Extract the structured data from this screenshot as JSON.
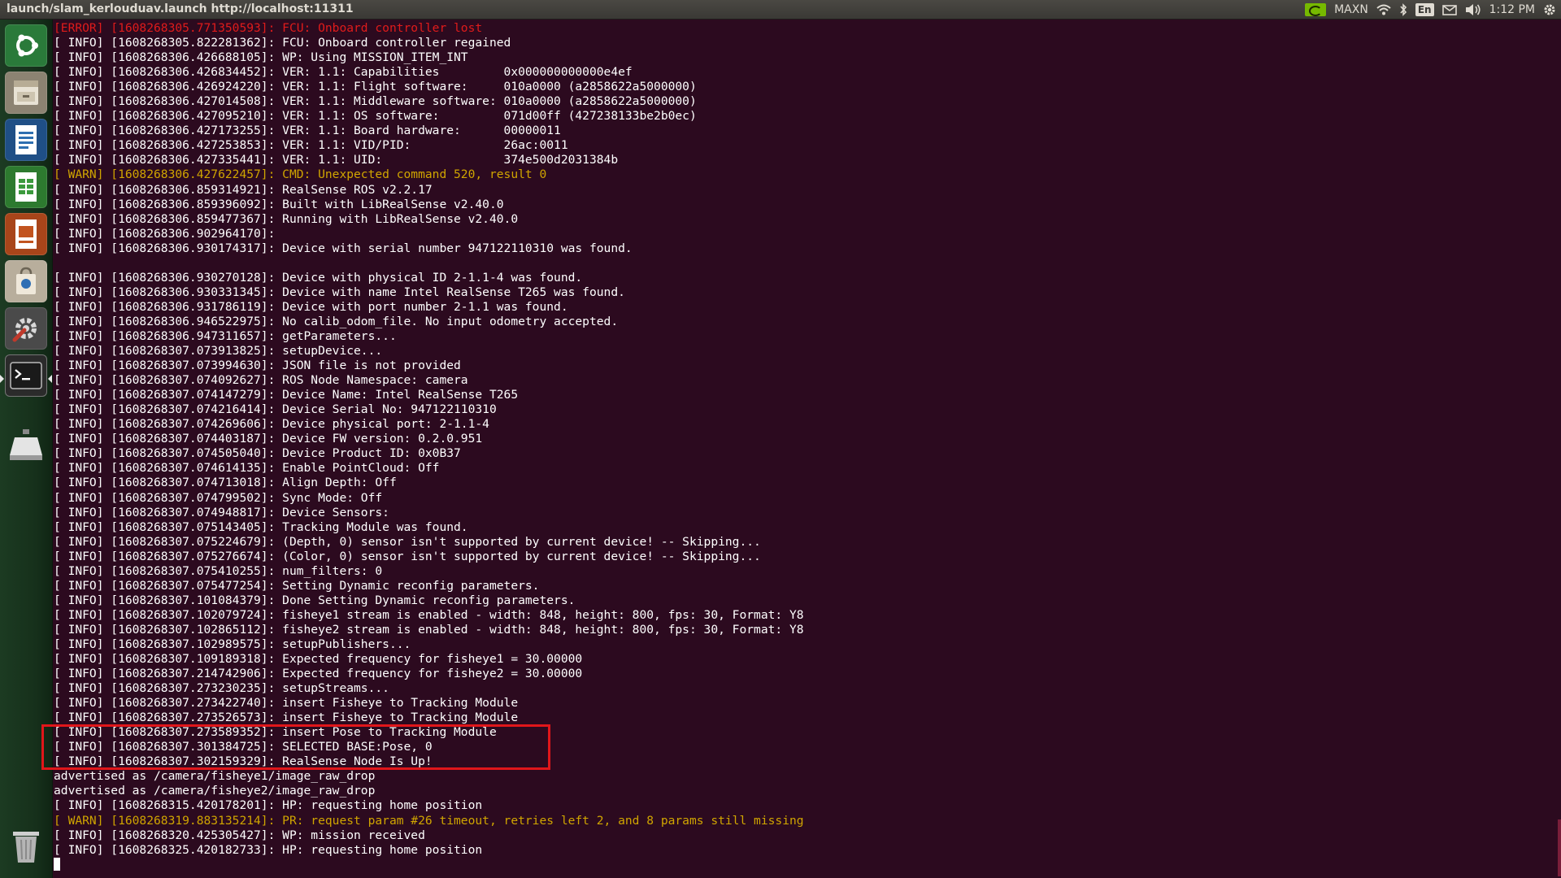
{
  "window": {
    "title": "launch/slam_kerlouduav.launch http://localhost:11311"
  },
  "tray": {
    "power_mode": "MAXN",
    "keyboard_layout": "En",
    "clock": "1:12 PM",
    "icons": [
      "nvidia-icon",
      "wifi-icon",
      "bluetooth-icon",
      "keyboard-icon",
      "mail-icon",
      "volume-icon",
      "gear-icon"
    ]
  },
  "launcher": {
    "items": [
      {
        "name": "dash-home",
        "icon": "ubuntu-logo-icon",
        "color": "#2a7a3a"
      },
      {
        "name": "files",
        "icon": "file-cabinet-icon",
        "color": "#a49a86"
      },
      {
        "name": "writer",
        "icon": "document-icon",
        "color": "#2e6fb0"
      },
      {
        "name": "calc",
        "icon": "spreadsheet-icon",
        "color": "#3b9a3d"
      },
      {
        "name": "impress",
        "icon": "presentation-icon",
        "color": "#c2541f"
      },
      {
        "name": "software",
        "icon": "shopping-bag-icon",
        "color": "#d8d2c6"
      },
      {
        "name": "settings",
        "icon": "settings-icon",
        "color": "#6a6a6a"
      },
      {
        "name": "terminal",
        "icon": "terminal-icon",
        "color": "#3a3a3a"
      },
      {
        "name": "drive",
        "icon": "drive-icon",
        "color": "#cfcfcf"
      },
      {
        "name": "trash",
        "icon": "trash-icon",
        "color": "#bdbdbd"
      }
    ]
  },
  "terminal": {
    "lines": [
      {
        "level": "error",
        "text": "[ERROR] [1608268305.771350593]: FCU: Onboard controller lost"
      },
      {
        "level": "info",
        "text": "[ INFO] [1608268305.822281362]: FCU: Onboard controller regained"
      },
      {
        "level": "info",
        "text": "[ INFO] [1608268306.426688105]: WP: Using MISSION_ITEM_INT"
      },
      {
        "level": "info",
        "text": "[ INFO] [1608268306.426834452]: VER: 1.1: Capabilities         0x000000000000e4ef"
      },
      {
        "level": "info",
        "text": "[ INFO] [1608268306.426924220]: VER: 1.1: Flight software:     010a0000 (a2858622a5000000)"
      },
      {
        "level": "info",
        "text": "[ INFO] [1608268306.427014508]: VER: 1.1: Middleware software: 010a0000 (a2858622a5000000)"
      },
      {
        "level": "info",
        "text": "[ INFO] [1608268306.427095210]: VER: 1.1: OS software:         071d00ff (427238133be2b0ec)"
      },
      {
        "level": "info",
        "text": "[ INFO] [1608268306.427173255]: VER: 1.1: Board hardware:      00000011"
      },
      {
        "level": "info",
        "text": "[ INFO] [1608268306.427253853]: VER: 1.1: VID/PID:             26ac:0011"
      },
      {
        "level": "info",
        "text": "[ INFO] [1608268306.427335441]: VER: 1.1: UID:                 374e500d2031384b"
      },
      {
        "level": "warn",
        "text": "[ WARN] [1608268306.427622457]: CMD: Unexpected command 520, result 0"
      },
      {
        "level": "info",
        "text": "[ INFO] [1608268306.859314921]: RealSense ROS v2.2.17"
      },
      {
        "level": "info",
        "text": "[ INFO] [1608268306.859396092]: Built with LibRealSense v2.40.0"
      },
      {
        "level": "info",
        "text": "[ INFO] [1608268306.859477367]: Running with LibRealSense v2.40.0"
      },
      {
        "level": "info",
        "text": "[ INFO] [1608268306.902964170]:"
      },
      {
        "level": "info",
        "text": "[ INFO] [1608268306.930174317]: Device with serial number 947122110310 was found."
      },
      {
        "level": "plain",
        "text": ""
      },
      {
        "level": "info",
        "text": "[ INFO] [1608268306.930270128]: Device with physical ID 2-1.1-4 was found."
      },
      {
        "level": "info",
        "text": "[ INFO] [1608268306.930331345]: Device with name Intel RealSense T265 was found."
      },
      {
        "level": "info",
        "text": "[ INFO] [1608268306.931786119]: Device with port number 2-1.1 was found."
      },
      {
        "level": "info",
        "text": "[ INFO] [1608268306.946522975]: No calib_odom_file. No input odometry accepted."
      },
      {
        "level": "info",
        "text": "[ INFO] [1608268306.947311657]: getParameters..."
      },
      {
        "level": "info",
        "text": "[ INFO] [1608268307.073913825]: setupDevice..."
      },
      {
        "level": "info",
        "text": "[ INFO] [1608268307.073994630]: JSON file is not provided"
      },
      {
        "level": "info",
        "text": "[ INFO] [1608268307.074092627]: ROS Node Namespace: camera"
      },
      {
        "level": "info",
        "text": "[ INFO] [1608268307.074147279]: Device Name: Intel RealSense T265"
      },
      {
        "level": "info",
        "text": "[ INFO] [1608268307.074216414]: Device Serial No: 947122110310"
      },
      {
        "level": "info",
        "text": "[ INFO] [1608268307.074269606]: Device physical port: 2-1.1-4"
      },
      {
        "level": "info",
        "text": "[ INFO] [1608268307.074403187]: Device FW version: 0.2.0.951"
      },
      {
        "level": "info",
        "text": "[ INFO] [1608268307.074505040]: Device Product ID: 0x0B37"
      },
      {
        "level": "info",
        "text": "[ INFO] [1608268307.074614135]: Enable PointCloud: Off"
      },
      {
        "level": "info",
        "text": "[ INFO] [1608268307.074713018]: Align Depth: Off"
      },
      {
        "level": "info",
        "text": "[ INFO] [1608268307.074799502]: Sync Mode: Off"
      },
      {
        "level": "info",
        "text": "[ INFO] [1608268307.074948817]: Device Sensors:"
      },
      {
        "level": "info",
        "text": "[ INFO] [1608268307.075143405]: Tracking Module was found."
      },
      {
        "level": "info",
        "text": "[ INFO] [1608268307.075224679]: (Depth, 0) sensor isn't supported by current device! -- Skipping..."
      },
      {
        "level": "info",
        "text": "[ INFO] [1608268307.075276674]: (Color, 0) sensor isn't supported by current device! -- Skipping..."
      },
      {
        "level": "info",
        "text": "[ INFO] [1608268307.075410255]: num_filters: 0"
      },
      {
        "level": "info",
        "text": "[ INFO] [1608268307.075477254]: Setting Dynamic reconfig parameters."
      },
      {
        "level": "info",
        "text": "[ INFO] [1608268307.101084379]: Done Setting Dynamic reconfig parameters."
      },
      {
        "level": "info",
        "text": "[ INFO] [1608268307.102079724]: fisheye1 stream is enabled - width: 848, height: 800, fps: 30, Format: Y8"
      },
      {
        "level": "info",
        "text": "[ INFO] [1608268307.102865112]: fisheye2 stream is enabled - width: 848, height: 800, fps: 30, Format: Y8"
      },
      {
        "level": "info",
        "text": "[ INFO] [1608268307.102989575]: setupPublishers..."
      },
      {
        "level": "info",
        "text": "[ INFO] [1608268307.109189318]: Expected frequency for fisheye1 = 30.00000"
      },
      {
        "level": "info",
        "text": "[ INFO] [1608268307.214742906]: Expected frequency for fisheye2 = 30.00000"
      },
      {
        "level": "info",
        "text": "[ INFO] [1608268307.273230235]: setupStreams..."
      },
      {
        "level": "info",
        "text": "[ INFO] [1608268307.273422740]: insert Fisheye to Tracking Module"
      },
      {
        "level": "info",
        "text": "[ INFO] [1608268307.273526573]: insert Fisheye to Tracking Module"
      },
      {
        "level": "info",
        "text": "[ INFO] [1608268307.273589352]: insert Pose to Tracking Module"
      },
      {
        "level": "info",
        "text": "[ INFO] [1608268307.301384725]: SELECTED BASE:Pose, 0"
      },
      {
        "level": "info",
        "text": "[ INFO] [1608268307.302159329]: RealSense Node Is Up!"
      },
      {
        "level": "plain",
        "text": "advertised as /camera/fisheye1/image_raw_drop"
      },
      {
        "level": "plain",
        "text": "advertised as /camera/fisheye2/image_raw_drop"
      },
      {
        "level": "info",
        "text": "[ INFO] [1608268315.420178201]: HP: requesting home position"
      },
      {
        "level": "warn",
        "text": "[ WARN] [1608268319.883135214]: PR: request param #26 timeout, retries left 2, and 8 params still missing"
      },
      {
        "level": "info",
        "text": "[ INFO] [1608268320.425305427]: WP: mission received"
      },
      {
        "level": "info",
        "text": "[ INFO] [1608268325.420182733]: HP: requesting home position"
      }
    ]
  },
  "colors": {
    "error": "#e01b1b",
    "warn": "#d0a500",
    "text": "#ffffff",
    "background": "#2c0a1f",
    "highlight": "#e0161a"
  }
}
